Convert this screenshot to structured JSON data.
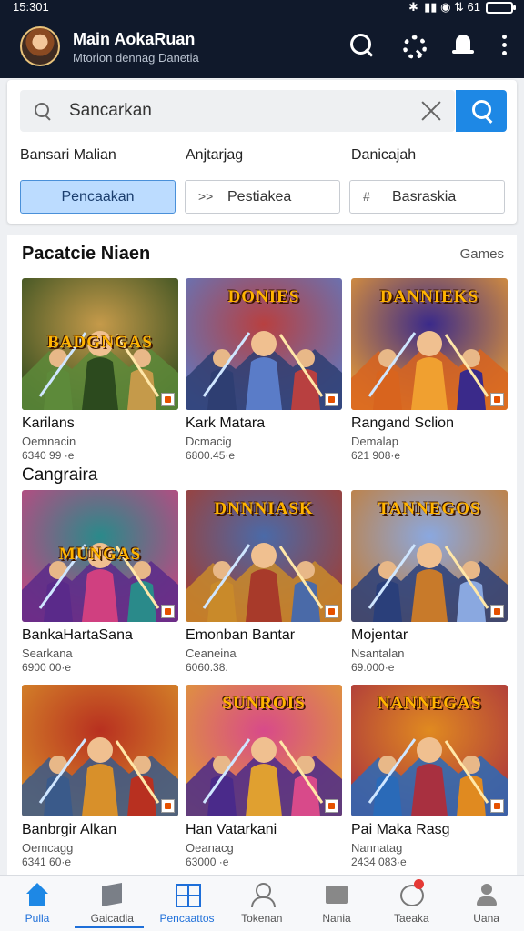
{
  "status_bar": {
    "time": "15:301",
    "signal_text": "✱  ▮▮ ◉ ⇅ 61"
  },
  "header": {
    "title": "Main AokaRuan",
    "subtitle": "Mtorion dennag Danetia",
    "icons": [
      "search-icon",
      "gear-icon",
      "bell-icon",
      "more-vert-icon"
    ]
  },
  "search": {
    "placeholder": "Sancarkan",
    "filters": [
      "Bansari Malian",
      "Anjtarjag",
      "Danicajah"
    ],
    "chips": [
      {
        "label": "Pencaakan",
        "icon": "",
        "selected": true
      },
      {
        "label": "Pestiakea",
        "icon": ">>",
        "selected": false
      },
      {
        "label": "Basraskia",
        "icon": "#",
        "selected": false
      }
    ]
  },
  "section": {
    "title": "Pacatcie Niaen",
    "more_label": "Games",
    "row2_title": "Cangraira"
  },
  "games": [
    {
      "name": "Karilans",
      "genre": "Oemnacin",
      "size": "6340 99 ·e",
      "logo": "BADGNGAS",
      "palette": [
        "#5d8a3a",
        "#c59a4a",
        "#2c4a1e"
      ]
    },
    {
      "name": "Kark Matara",
      "genre": "Dcmacig",
      "size": "6800.45·e",
      "logo": "DONIES",
      "palette": [
        "#2e3e72",
        "#b84040",
        "#5a7cc8"
      ]
    },
    {
      "name": "Rangand Sclion",
      "genre": "Demalap",
      "size": "621 908·e",
      "logo": "DANNIEKS",
      "palette": [
        "#d8641e",
        "#3a2a8a",
        "#f0a030"
      ]
    },
    {
      "name": "BankaHartaSana",
      "genre": "Searkana",
      "size": "6900 00·e",
      "logo": "MUNGAS",
      "palette": [
        "#5a2a8a",
        "#2a8a8a",
        "#d04080"
      ]
    },
    {
      "name": "Emonban Bantar",
      "genre": "Ceaneina",
      "size": "6060.38.",
      "logo": "DNNNIASK",
      "palette": [
        "#c98a2a",
        "#4a6aa8",
        "#a83a2a"
      ]
    },
    {
      "name": "Mojentar",
      "genre": "Nsantalan",
      "size": "69.000·e",
      "logo": "TANNEGOS",
      "palette": [
        "#2a3f7a",
        "#8aa8e0",
        "#c87a2a"
      ]
    },
    {
      "name": "Banbrgir Alkan",
      "genre": "Oemcagg",
      "size": "6341 60·e",
      "logo": "",
      "palette": [
        "#3a5a8a",
        "#b83020",
        "#d8902a"
      ]
    },
    {
      "name": "Han Vatarkani",
      "genre": "Oeanacg",
      "size": "63000 ·e",
      "logo": "SUNROIS",
      "palette": [
        "#4a2a8a",
        "#d84a8a",
        "#e0a030"
      ]
    },
    {
      "name": "Pai Maka Rasg",
      "genre": "Nannatag",
      "size": "2434 083·e",
      "logo": "NANNEGAS",
      "palette": [
        "#2a6ab8",
        "#e08a20",
        "#a83040"
      ]
    }
  ],
  "bottom_nav": [
    {
      "label": "Pulla",
      "icon": "home-icon",
      "active": true
    },
    {
      "label": "Gaicadia",
      "icon": "book-icon",
      "active": false
    },
    {
      "label": "Pencaattos",
      "icon": "grid-icon",
      "active": true
    },
    {
      "label": "Tokenan",
      "icon": "user-outline-icon",
      "active": false
    },
    {
      "label": "Nania",
      "icon": "box-icon",
      "active": false
    },
    {
      "label": "Taeaka",
      "icon": "chat-icon",
      "active": false
    },
    {
      "label": "Uana",
      "icon": "person-icon",
      "active": false
    }
  ]
}
